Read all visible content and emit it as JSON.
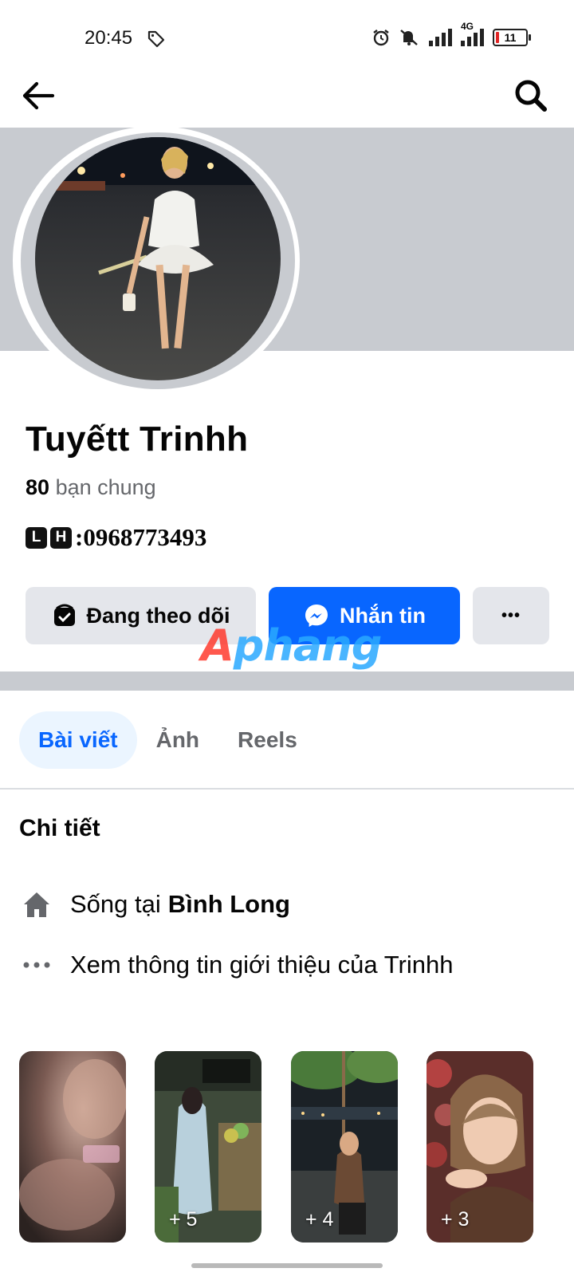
{
  "status_bar": {
    "time": "20:45",
    "battery": "11",
    "network": "4G",
    "icons": [
      "tag-icon",
      "alarm-icon",
      "mute-icon",
      "signal-icon",
      "battery-icon"
    ]
  },
  "header": {
    "back_icon": "arrow-left-icon",
    "search_icon": "search-icon"
  },
  "profile": {
    "name": "Tuyếtt Trinhh",
    "mutual_count": "80",
    "mutual_label": "bạn chung",
    "contact_box_1": "L",
    "contact_box_2": "H",
    "contact_text": ":0968773493"
  },
  "actions": {
    "following_label": "Đang theo dõi",
    "message_label": "Nhắn tin",
    "more_label": "•••"
  },
  "watermark": {
    "part1": "A",
    "part2": "phang"
  },
  "tabs": [
    {
      "label": "Bài viết",
      "active": true
    },
    {
      "label": "Ảnh",
      "active": false
    },
    {
      "label": "Reels",
      "active": false
    }
  ],
  "details": {
    "title": "Chi tiết",
    "lives_in_prefix": "Sống tại",
    "lives_in_place": "Bình Long",
    "about_link": "Xem thông tin giới thiệu của Trinhh"
  },
  "photos": [
    {
      "count": ""
    },
    {
      "count": "+ 5"
    },
    {
      "count": "+ 4"
    },
    {
      "count": "+ 3"
    }
  ],
  "colors": {
    "accent": "#0866ff",
    "cover": "#c8cbd0",
    "button_gray": "#e4e6eb",
    "tab_active_bg": "#ebf5ff"
  }
}
